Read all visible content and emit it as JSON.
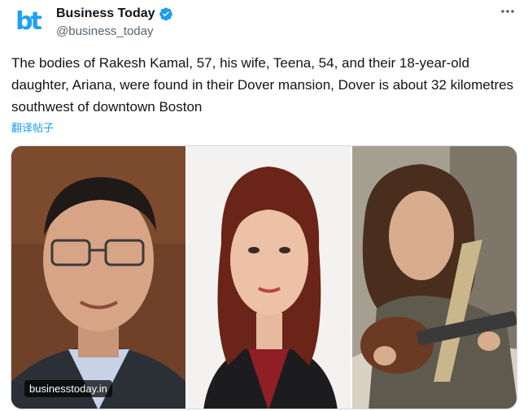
{
  "post": {
    "avatar": {
      "label": "bt",
      "icon": "business-today-logo"
    },
    "display_name": "Business Today",
    "handle": "@business_today",
    "verified_icon": "verified-badge-icon",
    "more_icon": "more-icon",
    "text": "The bodies of Rakesh Kamal, 57, his wife, Teena, 54, and their 18-year-old daughter, Ariana, were found in their Dover mansion, Dover is about 32 kilometres southwest of downtown Boston",
    "translate_label": "翻译帖子",
    "media": {
      "source": "businesstoday.in",
      "photos": [
        "photo-man-glasses",
        "photo-woman-red-hair",
        "photo-girl-guitar"
      ]
    }
  },
  "colors": {
    "accent": "#1d9bf0",
    "text": "#0f1419",
    "secondary": "#536471",
    "border": "#cfd9de"
  }
}
